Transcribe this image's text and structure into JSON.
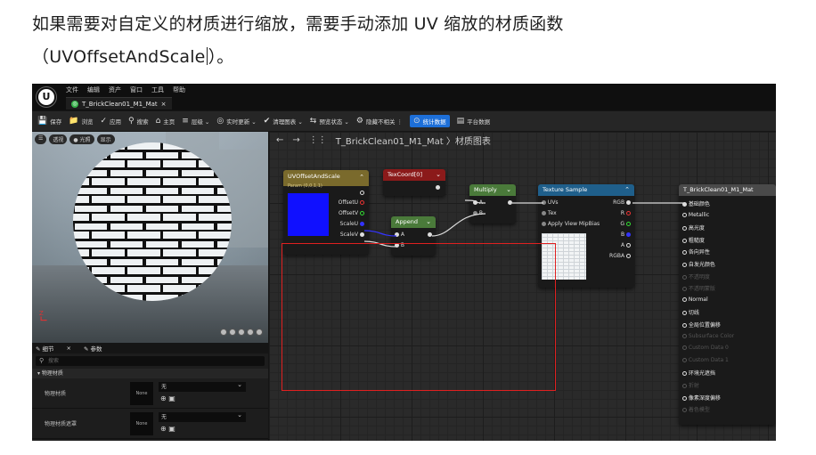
{
  "doc": {
    "line1": "如果需要对自定义的材质进行缩放，需要手动添加 UV 缩放的材质函数",
    "line2_open": "（UVOffsetAndScale",
    "line2_close": "）。"
  },
  "editor": {
    "menu": [
      "文件",
      "编辑",
      "资产",
      "窗口",
      "工具",
      "帮助"
    ],
    "tab_title": "T_BrickClean01_M1_Mat",
    "tab_close": "×",
    "toolbar": [
      {
        "icon": "save-icon",
        "glyph": "💾",
        "label": "保存"
      },
      {
        "icon": "browse-icon",
        "glyph": "📁",
        "label": "浏览"
      },
      {
        "icon": "apply-icon",
        "glyph": "✓",
        "label": "应用"
      },
      {
        "icon": "search-icon",
        "glyph": "⚲",
        "label": "搜索"
      },
      {
        "icon": "home-icon",
        "glyph": "⌂",
        "label": "主页"
      },
      {
        "icon": "hierarchy-icon",
        "glyph": "≡",
        "label": "层级 ⌄"
      },
      {
        "icon": "live-update-icon",
        "glyph": "◎",
        "label": "实时更新 ⌄"
      },
      {
        "icon": "clean-graph-icon",
        "glyph": "✔",
        "label": "清理图表 ⌄"
      },
      {
        "icon": "preview-state-icon",
        "glyph": "⇆",
        "label": "预览状态 ⌄"
      },
      {
        "icon": "hide-unrelated-icon",
        "glyph": "⚙",
        "label": "隐藏不相关 ⋮"
      },
      {
        "icon": "stats-icon",
        "glyph": "⊙",
        "label": "统计数据",
        "active": true
      },
      {
        "icon": "platform-stats-icon",
        "glyph": "▤",
        "label": "平台数据"
      }
    ],
    "viewport": {
      "buttons": [
        "☰",
        "透视",
        "● 光照",
        "显示"
      ],
      "axis_label": "Z"
    },
    "details": {
      "tabs": [
        "✎ 细节",
        "×",
        "✎ 参数"
      ],
      "search_placeholder": "搜索",
      "category": "▾ 物理材质",
      "rows": [
        {
          "label": "物理材质",
          "thumb": "None",
          "value": "无"
        },
        {
          "label": "物理材质遮罩",
          "thumb": "None",
          "value": "无"
        }
      ]
    },
    "graph": {
      "breadcrumb": "T_BrickClean01_M1_Mat 〉材质图表",
      "nodes": {
        "uvoffset": {
          "title": "UVOffsetAndScale",
          "subtitle": "Param (0,0,1,1)",
          "pins_out": [
            "OffsetU",
            "OffsetV",
            "ScaleU",
            "ScaleV"
          ]
        },
        "texcoord": {
          "title": "TexCoord[0]"
        },
        "append": {
          "title": "Append",
          "pins": [
            "A",
            "B"
          ]
        },
        "multiply": {
          "title": "Multiply",
          "pins": [
            "A",
            "B"
          ]
        },
        "texture": {
          "title": "Texture Sample",
          "inputs": [
            "UVs",
            "Tex",
            "Apply View MipBias"
          ],
          "outputs": [
            "RGB",
            "R",
            "G",
            "B",
            "A",
            "RGBA"
          ]
        },
        "material": {
          "title": "T_BrickClean01_M1_Mat",
          "pins": [
            {
              "label": "基础颜色",
              "enabled": true
            },
            {
              "label": "Metallic",
              "enabled": true
            },
            {
              "label": "高光度",
              "enabled": true
            },
            {
              "label": "粗糙度",
              "enabled": true
            },
            {
              "label": "各向异性",
              "enabled": true
            },
            {
              "label": "自发光颜色",
              "enabled": true
            },
            {
              "label": "不透明度",
              "enabled": false
            },
            {
              "label": "不透明蒙版",
              "enabled": false
            },
            {
              "label": "Normal",
              "enabled": true
            },
            {
              "label": "切线",
              "enabled": true
            },
            {
              "label": "全局位置偏移",
              "enabled": true
            },
            {
              "label": "Subsurface Color",
              "enabled": false
            },
            {
              "label": "Custom Data 0",
              "enabled": false
            },
            {
              "label": "Custom Data 1",
              "enabled": false
            },
            {
              "label": "环境光遮挡",
              "enabled": true
            },
            {
              "label": "折射",
              "enabled": false
            },
            {
              "label": "像素深度偏移",
              "enabled": true
            },
            {
              "label": "着色模型",
              "enabled": false
            }
          ]
        }
      }
    }
  },
  "colors": {
    "uvoffset_header": "#7a6a2c",
    "texcoord_header": "#8b1a1a",
    "math_header": "#4a7a3a",
    "texture_header": "#1f5f8b",
    "material_header": "#4a4a4a",
    "highlight": "#e02020"
  }
}
